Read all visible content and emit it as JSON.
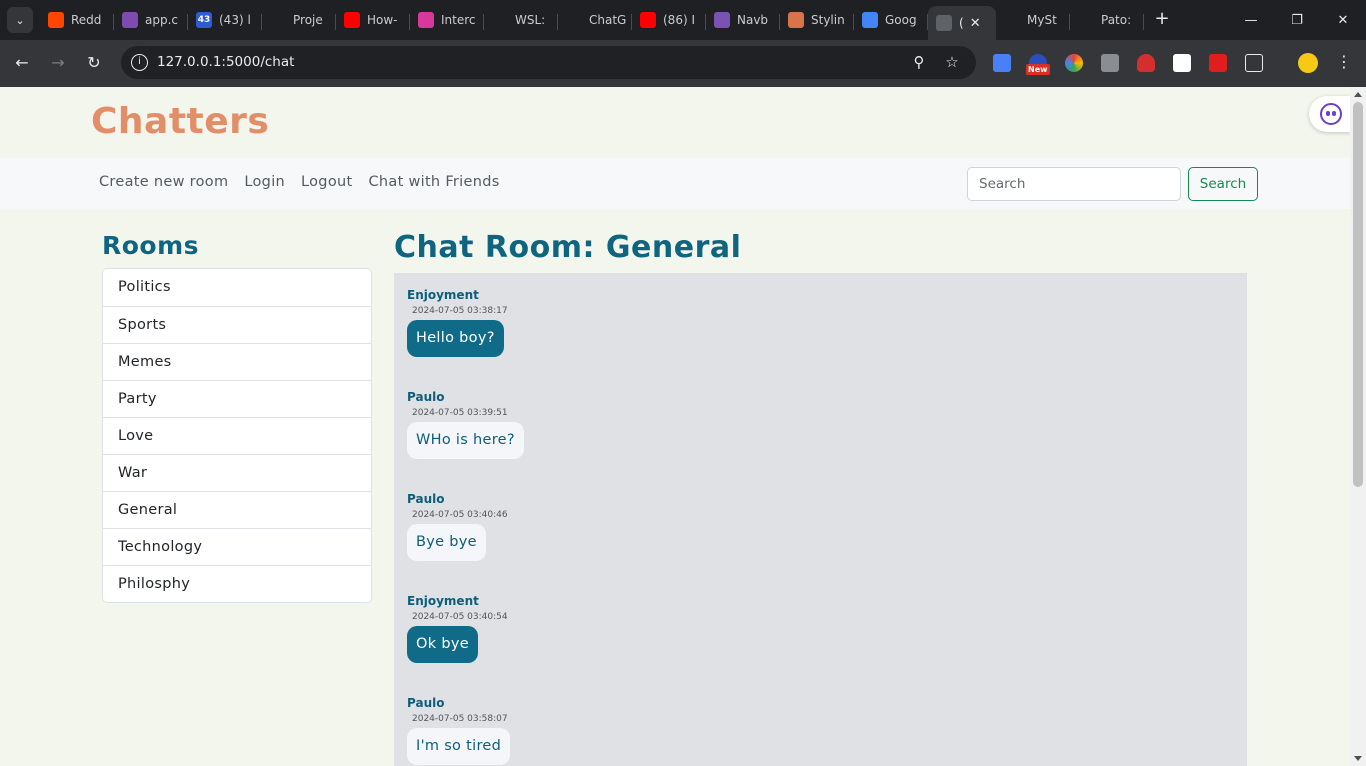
{
  "browser": {
    "tabs": [
      {
        "title": "Redd",
        "icon": "reddit-icon",
        "color": "#ff4500"
      },
      {
        "title": "app.c",
        "icon": "app-icon",
        "color": "#7e4bb0"
      },
      {
        "title": "(43) l",
        "icon": "notification-icon",
        "color": "#2d5bd6",
        "badge": "43"
      },
      {
        "title": "Proje",
        "icon": "project-icon",
        "color": "#1f2023"
      },
      {
        "title": "How-",
        "icon": "youtube-icon",
        "color": "#ff0000"
      },
      {
        "title": "Interc",
        "icon": "trello-icon",
        "color": "#d6399b"
      },
      {
        "title": "WSL:",
        "icon": "github-icon",
        "color": "#1f2023"
      },
      {
        "title": "ChatG",
        "icon": "chatgpt-icon",
        "color": "#1f2023"
      },
      {
        "title": "(86) I",
        "icon": "youtube-icon",
        "color": "#ff0000"
      },
      {
        "title": "Navb",
        "icon": "bootstrap-icon",
        "color": "#7952b3"
      },
      {
        "title": "Stylin",
        "icon": "sparkle-icon",
        "color": "#d9744a"
      },
      {
        "title": "Goog",
        "icon": "google-icon",
        "color": "#4285f4"
      },
      {
        "title": "(",
        "icon": "globe-icon",
        "color": "#5f6368",
        "active": true
      },
      {
        "title": "MySt",
        "icon": "github-icon",
        "color": "#1f2023"
      },
      {
        "title": "Pato:",
        "icon": "github-icon",
        "color": "#1f2023"
      }
    ],
    "url": "127.0.0.1:5000/chat",
    "new_badge": "New"
  },
  "site": {
    "brand": "Chatters",
    "nav_links": [
      "Create new room",
      "Login",
      "Logout",
      "Chat with Friends"
    ],
    "search_placeholder": "Search",
    "search_button": "Search"
  },
  "sidebar": {
    "title": "Rooms",
    "rooms": [
      "Politics",
      "Sports",
      "Memes",
      "Party",
      "Love",
      "War",
      "General",
      "Technology",
      "Philosphy"
    ]
  },
  "chat": {
    "title": "Chat Room: General",
    "messages": [
      {
        "user": "Enjoyment",
        "time": "2024-07-05 03:38:17",
        "text": "Hello boy?",
        "style": "mine"
      },
      {
        "user": "Paulo",
        "time": "2024-07-05 03:39:51",
        "text": "WHo is here?",
        "style": "other"
      },
      {
        "user": "Paulo",
        "time": "2024-07-05 03:40:46",
        "text": "Bye bye",
        "style": "other"
      },
      {
        "user": "Enjoyment",
        "time": "2024-07-05 03:40:54",
        "text": "Ok bye",
        "style": "mine"
      },
      {
        "user": "Paulo",
        "time": "2024-07-05 03:58:07",
        "text": "I'm so tired",
        "style": "other"
      }
    ]
  },
  "colors": {
    "brand": "#e28e69",
    "heading": "#0f6580",
    "own_bubble": "#0f6b87",
    "other_bubble": "#f4f6fa",
    "search_button": "#198754"
  }
}
